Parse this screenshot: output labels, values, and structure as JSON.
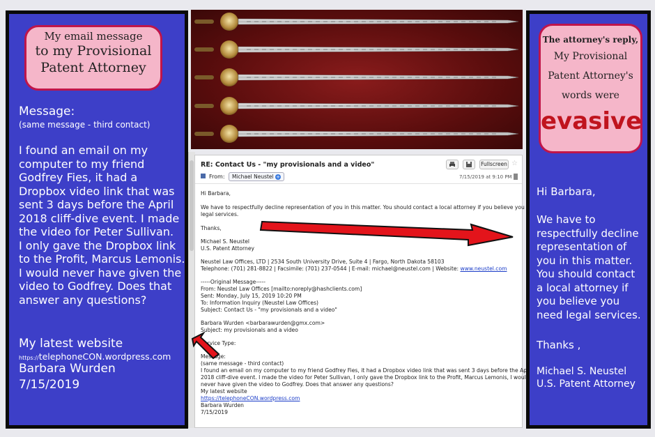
{
  "left_panel": {
    "bubble_line1": "My email message",
    "bubble_line2": "to my Provisional",
    "bubble_line3": "Patent Attorney",
    "message_heading": "Message:",
    "message_sub": "(same message - third contact)",
    "message_lines": [
      "I found an email on my",
      "computer to my friend",
      "Godfrey Fies, it had a",
      "Dropbox video link that was",
      "sent 3 days before the April",
      "2018 cliff-dive event. I made",
      "the video for Peter Sullivan.",
      "I only gave the Dropbox link",
      "to the Profit, Marcus Lemonis.",
      "I would never have given the",
      "video to Godfrey. Does that",
      "answer any questions?"
    ],
    "website_label": "My latest website",
    "website_url_prefix": "https://",
    "website_url": "telephoneCON.wordpress.com",
    "name": "Barbara Wurden",
    "date": "7/15/2019"
  },
  "right_panel": {
    "bubble_line1": "The attorney's reply,",
    "bubble_line2": "My Provisional",
    "bubble_line3": "Patent Attorney's",
    "bubble_line4": "words were",
    "bubble_emphasis": "evasive",
    "greeting": "Hi Barbara,",
    "reply_lines": [
      "We have to",
      "respectfully decline",
      "representation of",
      "you in this matter.",
      "You should contact",
      "a local attorney if",
      "you believe you",
      "need legal services."
    ],
    "thanks": "Thanks ,",
    "signature_name": "Michael S. Neustel",
    "signature_title": "U.S. Patent Attorney"
  },
  "email": {
    "subject": "RE: Contact Us - \"my provisionals and a video\"",
    "from_label": "From:",
    "from_name": "Michael Neustel",
    "date": "7/15/2019 at 9:10 PM",
    "fullscreen_label": "Fullscreen",
    "greeting": "Hi Barbara,",
    "body1": "We have to respectfully decline representation of you in this matter. You should contact a local attorney if you believe you need",
    "body2": "legal services.",
    "thanks": "Thanks,",
    "sig_name": "Michael S. Neustel",
    "sig_title": "U.S. Patent Attorney",
    "office_line": "Neustel Law Offices, LTD | 2534 South University Drive, Suite 4 | Fargo, North Dakota 58103",
    "phone_line": "Telephone: (701) 281-8822 | Facsimile: (701) 237-0544 | E-mail: michael@neustel.com | Website: ",
    "website_link": "www.neustel.com",
    "original_header": "-----Original Message-----",
    "orig_from": "From: Neustel Law Offices [mailto:noreply@hashclients.com]",
    "orig_sent": "Sent: Monday, July 15, 2019 10:20 PM",
    "orig_to": "To: Information Inquiry (Neustel Law Offices)",
    "orig_subject": "Subject: Contact Us - \"my provisionals and a video\"",
    "sender_line": "Barbara Wurden <barbarawurden@gmx.com>",
    "sender_subject": "Subject: my provisionals and a video",
    "service_type": "Service Type:",
    "message_label": "Message:",
    "msg_sub": "(same message - third contact)",
    "msg1": "I found an email on my computer to my friend Godfrey Fies, it had a Dropbox video link that was sent 3 days before the April",
    "msg2": "2018 cliff-dive event. I made the video for Peter Sullivan, I only gave the Dropbox link to the Profit, Marcus Lemonis, I would",
    "msg3": "never have given the video to Godfrey. Does that answer any questions?",
    "msg_site_label": "My latest website",
    "msg_site_link": "https://telephoneCON.wordpress.com",
    "msg_name": "Barbara Wurden",
    "msg_date": "7/15/2019"
  },
  "colors": {
    "panel_blue": "#3d3fc8",
    "bubble_pink": "#f5b6c9",
    "bubble_border": "#c0154a",
    "arrow_red": "#e3141b"
  }
}
